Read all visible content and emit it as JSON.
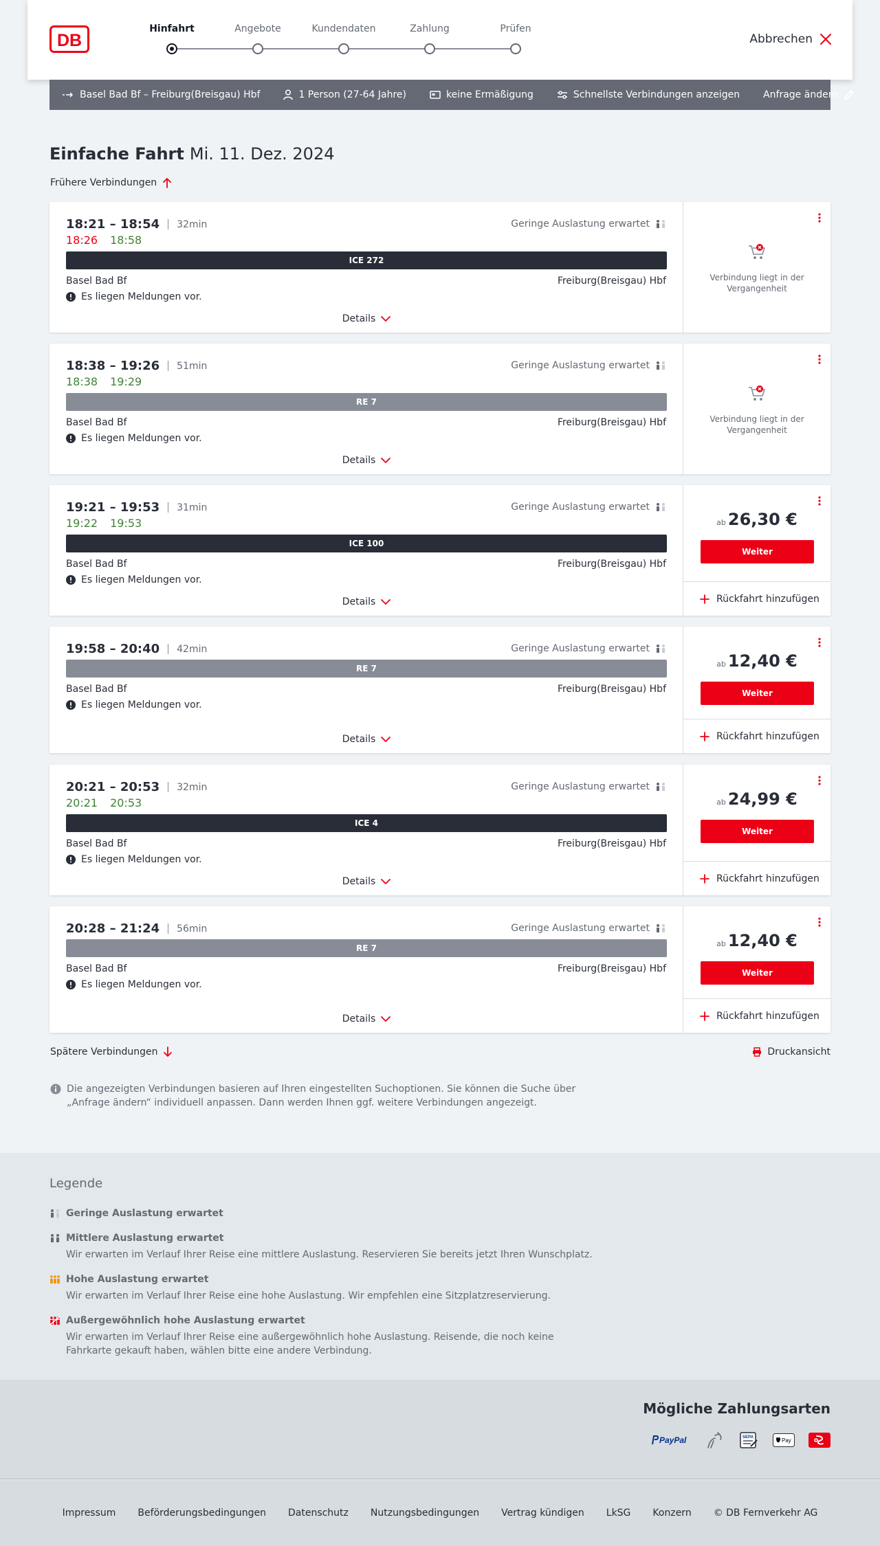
{
  "header": {
    "logo": "DB",
    "steps": [
      "Hinfahrt",
      "Angebote",
      "Kundendaten",
      "Zahlung",
      "Prüfen"
    ],
    "active_step": 0,
    "cancel_label": "Abbrechen"
  },
  "request": {
    "route": "Basel Bad Bf – Freiburg(Breisgau) Hbf",
    "travelers": "1 Person (27-64 Jahre)",
    "discount": "keine Ermäßigung",
    "options": "Schnellste Verbindungen anzeigen",
    "change_label": "Anfrage ändern"
  },
  "title": {
    "trip_type": "Einfache Fahrt",
    "date": "Mi. 11. Dez. 2024"
  },
  "earlier_label": "Frühere Verbindungen",
  "later_label": "Spätere Verbindungen",
  "print_label": "Druckansicht",
  "connections": [
    {
      "times": "18:21 – 18:54",
      "duration": "32min",
      "rt_dep": "18:26",
      "rt_arr": "18:58",
      "load": "Geringe Auslastung erwartet",
      "train": "ICE 272",
      "from": "Basel Bad Bf",
      "to": "Freiburg(Breisgau) Hbf",
      "notice": "Es liegen Meldungen vor.",
      "details": "Details",
      "status": "Verbindung liegt in der Vergangenheit"
    },
    {
      "times": "18:38 – 19:26",
      "duration": "51min",
      "rt_dep": "18:38",
      "rt_arr": "19:29",
      "load": "Geringe Auslastung erwartet",
      "train": "RE 7",
      "from": "Basel Bad Bf",
      "to": "Freiburg(Breisgau) Hbf",
      "notice": "Es liegen Meldungen vor.",
      "details": "Details",
      "status": "Verbindung liegt in der Vergangenheit"
    },
    {
      "times": "19:21 – 19:53",
      "duration": "31min",
      "rt_dep": "19:22",
      "rt_arr": "19:53",
      "load": "Geringe Auslastung erwartet",
      "train": "ICE 100",
      "from": "Basel Bad Bf",
      "to": "Freiburg(Breisgau) Hbf",
      "notice": "Es liegen Meldungen vor.",
      "details": "Details",
      "price_prefix": "ab",
      "price": "26,30 €",
      "button": "Weiter",
      "return_label": "Rückfahrt hinzufügen"
    },
    {
      "times": "19:58 – 20:40",
      "duration": "42min",
      "load": "Geringe Auslastung erwartet",
      "train": "RE 7",
      "from": "Basel Bad Bf",
      "to": "Freiburg(Breisgau) Hbf",
      "notice": "Es liegen Meldungen vor.",
      "details": "Details",
      "price_prefix": "ab",
      "price": "12,40 €",
      "button": "Weiter",
      "return_label": "Rückfahrt hinzufügen"
    },
    {
      "times": "20:21 – 20:53",
      "duration": "32min",
      "rt_dep": "20:21",
      "rt_arr": "20:53",
      "load": "Geringe Auslastung erwartet",
      "train": "ICE 4",
      "from": "Basel Bad Bf",
      "to": "Freiburg(Breisgau) Hbf",
      "notice": "Es liegen Meldungen vor.",
      "details": "Details",
      "price_prefix": "ab",
      "price": "24,99 €",
      "button": "Weiter",
      "return_label": "Rückfahrt hinzufügen"
    },
    {
      "times": "20:28 – 21:24",
      "duration": "56min",
      "load": "Geringe Auslastung erwartet",
      "train": "RE 7",
      "from": "Basel Bad Bf",
      "to": "Freiburg(Breisgau) Hbf",
      "notice": "Es liegen Meldungen vor.",
      "details": "Details",
      "price_prefix": "ab",
      "price": "12,40 €",
      "button": "Weiter",
      "return_label": "Rückfahrt hinzufügen"
    }
  ],
  "info_text": "Die angezeigten Verbindungen basieren auf Ihren eingestellten Suchoptionen. Sie können die Suche über „Anfrage ändern“ individuell anpassen. Dann werden Ihnen ggf. weitere Verbindungen angezeigt.",
  "legend": {
    "title": "Legende",
    "items": [
      {
        "title": "Geringe Auslastung erwartet",
        "desc": ""
      },
      {
        "title": "Mittlere Auslastung erwartet",
        "desc": "Wir erwarten im Verlauf Ihrer Reise eine mittlere Auslastung. Reservieren Sie bereits jetzt Ihren Wunschplatz."
      },
      {
        "title": "Hohe Auslastung erwartet",
        "desc": "Wir erwarten im Verlauf Ihrer Reise eine hohe Auslastung. Wir empfehlen eine Sitzplatzreservierung."
      },
      {
        "title": "Außergewöhnlich hohe Auslastung erwartet",
        "desc": "Wir erwarten im Verlauf Ihrer Reise eine außergewöhnlich hohe Auslastung. Reisende, die noch keine Fahrkarte gekauft haben, wählen bitte eine andere Verbindung."
      }
    ]
  },
  "payment": {
    "title": "Mögliche Zahlungsarten",
    "paypal": "PayPal",
    "sepa": "SEPA",
    "applepay": "Pay"
  },
  "footer": [
    "Impressum",
    "Beförderungsbedingungen",
    "Datenschutz",
    "Nutzungsbedingungen",
    "Vertrag kündigen",
    "LkSG",
    "Konzern",
    "© DB Fernverkehr AG"
  ],
  "colors": {
    "brand_red": "#ec0016",
    "realtime_green": "#408335",
    "dark": "#282d37",
    "grey_train": "#878c96",
    "load_low": "#646973",
    "load_high": "#f39200"
  }
}
